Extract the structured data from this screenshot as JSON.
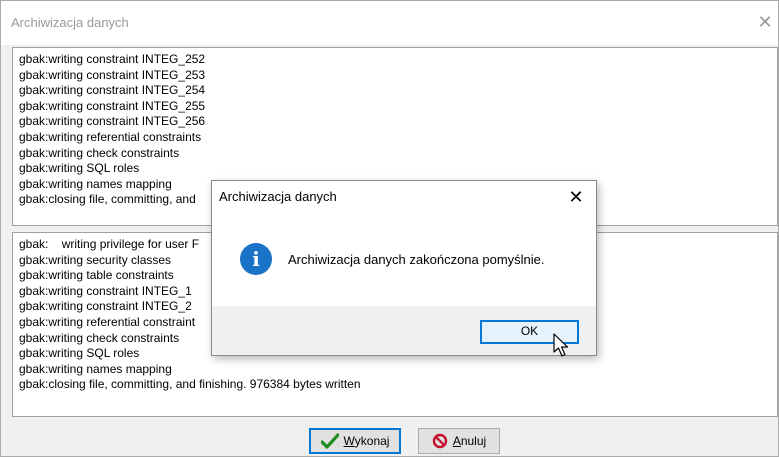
{
  "window": {
    "title": "Archiwizacja danych",
    "close_glyph": "✕"
  },
  "log_top": {
    "lines": [
      "gbak:writing constraint INTEG_252",
      "gbak:writing constraint INTEG_253",
      "gbak:writing constraint INTEG_254",
      "gbak:writing constraint INTEG_255",
      "gbak:writing constraint INTEG_256",
      "gbak:writing referential constraints",
      "gbak:writing check constraints",
      "gbak:writing SQL roles",
      "gbak:writing names mapping",
      "gbak:closing file, committing, and"
    ]
  },
  "log_bottom": {
    "lines": [
      "gbak:    writing privilege for user F",
      "gbak:writing security classes",
      "gbak:writing table constraints",
      "gbak:writing constraint INTEG_1",
      "gbak:writing constraint INTEG_2",
      "gbak:writing referential constraint",
      "gbak:writing check constraints",
      "gbak:writing SQL roles",
      "gbak:writing names mapping",
      "gbak:closing file, committing, and finishing. 976384 bytes written"
    ]
  },
  "buttons": {
    "execute_prefix": "W",
    "execute_rest": "ykonaj",
    "cancel_prefix": "A",
    "cancel_rest": "nuluj"
  },
  "modal": {
    "title": "Archiwizacja danych",
    "close_glyph": "✕",
    "icon": "info-icon",
    "icon_glyph": "i",
    "message": "Archiwizacja danych zakończona pomyślnie.",
    "ok_label": "OK"
  },
  "colors": {
    "accent": "#0078d7",
    "info_icon": "#1a73c8",
    "check_green": "#1e8c1e",
    "cancel_red": "#c8102e"
  }
}
